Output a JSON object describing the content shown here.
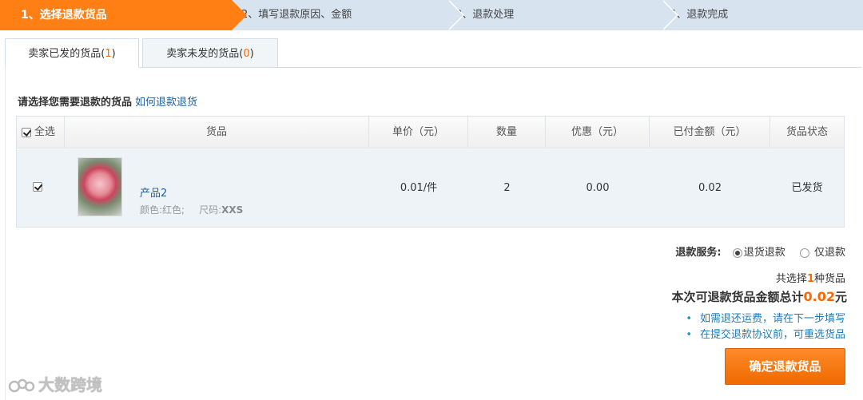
{
  "steps": [
    {
      "label": "1、选择退款货品"
    },
    {
      "label": "2、填写退款原因、金额"
    },
    {
      "label": "3、退款处理"
    },
    {
      "label": "4、退款完成"
    }
  ],
  "tabs": [
    {
      "label": "卖家已发的货品(",
      "count": "1",
      "close": ")"
    },
    {
      "label": "卖家未发的货品(",
      "count": "0",
      "close": ")"
    }
  ],
  "prompt": {
    "text": "请选择您需要退款的货品",
    "link": "如何退款退货"
  },
  "table": {
    "headers": [
      "全选",
      "货品",
      "单价（元）",
      "数量",
      "优惠（元）",
      "已付金额（元）",
      "货品状态"
    ],
    "select_all_checked": true,
    "rows": [
      {
        "checked": true,
        "name": "产品2",
        "color_label": "颜色:红色;",
        "size_label": "尺码:",
        "size_value": "XXS",
        "unit_price": "0.01/件",
        "quantity": "2",
        "discount": "0.00",
        "paid": "0.02",
        "status": "已发货"
      }
    ]
  },
  "service": {
    "label": "退款服务:",
    "options": [
      {
        "label": "退货退款",
        "selected": true
      },
      {
        "label": "仅退款",
        "selected": false
      }
    ]
  },
  "summary": {
    "count_prefix": "共选择",
    "count": "1",
    "count_suffix": "种货品",
    "total_prefix": "本次可退款货品金额总计",
    "total_amount": "0.02",
    "total_suffix": "元"
  },
  "tips": [
    "如需退还运费，请在下一步填写",
    "在提交退款协议前，可重选货品"
  ],
  "confirm_label": "确定退款货品",
  "watermark": "大数跨境",
  "colors": {
    "accent": "#ff7f14",
    "link": "#1f5f9c",
    "highlight": "#ff6600"
  }
}
